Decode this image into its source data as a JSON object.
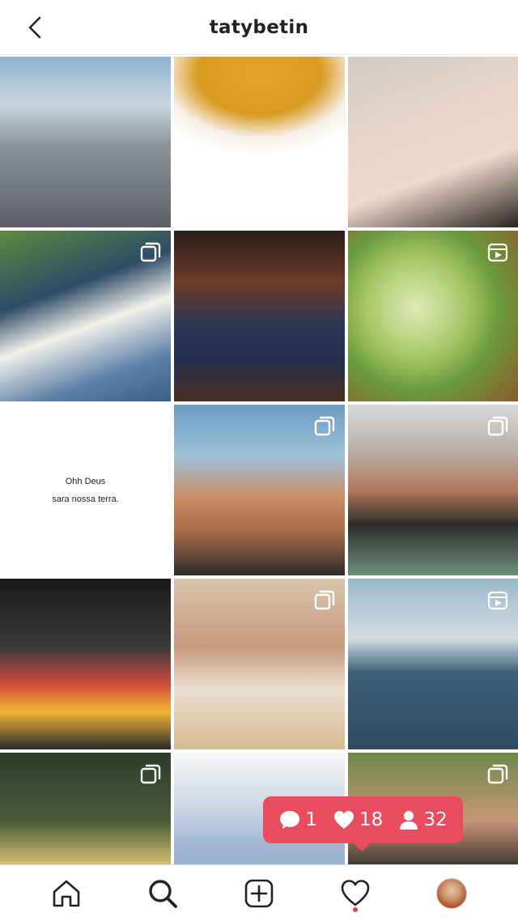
{
  "header": {
    "title": "tatybetin",
    "back_icon": "chevron-left-icon"
  },
  "grid": {
    "tiles": [
      {
        "description": "",
        "badge": "none"
      },
      {
        "description": "",
        "badge": "none"
      },
      {
        "description": "",
        "badge": "none"
      },
      {
        "description": "",
        "badge": "carousel-icon"
      },
      {
        "description": "",
        "badge": "none"
      },
      {
        "description": "",
        "badge": "reels-icon"
      },
      {
        "description": "",
        "badge": "none",
        "text_lines": [
          "Ohh Deus",
          "sara nossa terra."
        ]
      },
      {
        "description": "",
        "badge": "carousel-icon"
      },
      {
        "description": "",
        "badge": "carousel-icon"
      },
      {
        "description": "",
        "badge": "none"
      },
      {
        "description": "",
        "badge": "carousel-icon"
      },
      {
        "description": "",
        "badge": "reels-icon"
      },
      {
        "description": "",
        "badge": "carousel-icon"
      },
      {
        "description": "",
        "badge": "none"
      },
      {
        "description": "",
        "badge": "carousel-icon"
      }
    ]
  },
  "notification": {
    "comments": "1",
    "likes": "18",
    "followers": "32",
    "color": "#ea4c5f"
  },
  "bottom_nav": {
    "items": [
      {
        "icon": "home-icon"
      },
      {
        "icon": "search-icon"
      },
      {
        "icon": "add-post-icon"
      },
      {
        "icon": "heart-icon",
        "has_notification_dot": true
      },
      {
        "icon": "profile-avatar"
      }
    ],
    "dot_color": "#e23b4e"
  }
}
